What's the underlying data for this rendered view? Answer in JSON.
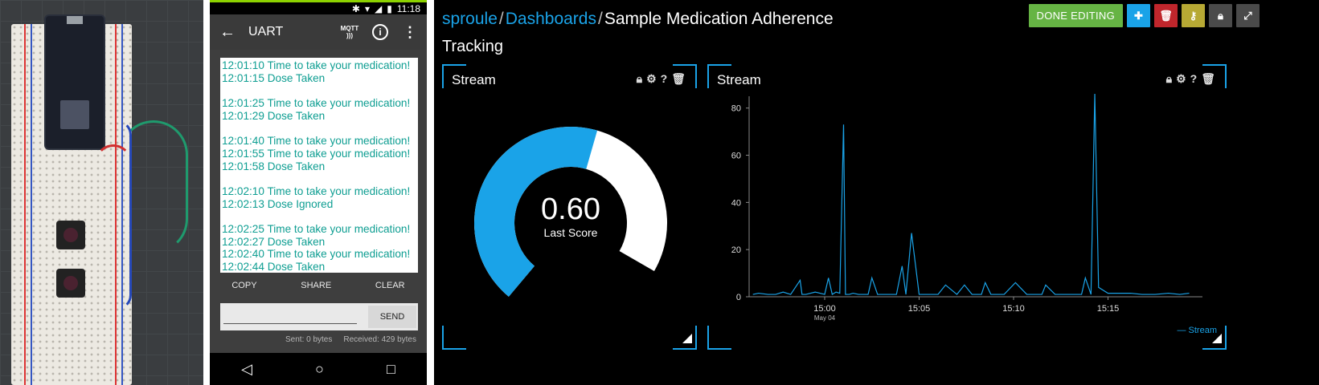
{
  "phone": {
    "status_time": "11:18",
    "title": "UART",
    "mqtt_label": "MQTT",
    "log_groups": [
      [
        "12:01:10 Time to take your medication!",
        "12:01:15 Dose Taken"
      ],
      [
        "12:01:25 Time to take your medication!",
        "12:01:29 Dose Taken"
      ],
      [
        "12:01:40 Time to take your medication!",
        "12:01:55 Time to take your medication!",
        "12:01:58 Dose Taken"
      ],
      [
        "12:02:10 Time to take your medication!",
        "12:02:13 Dose Ignored"
      ],
      [
        "12:02:25 Time to take your medication!",
        "12:02:27 Dose Taken",
        "12:02:40 Time to take your medication!",
        "12:02:44 Dose Taken"
      ]
    ],
    "actions": {
      "copy": "COPY",
      "share": "SHARE",
      "clear": "CLEAR"
    },
    "send_label": "SEND",
    "sent": "Sent: 0 bytes",
    "received": "Received: 429 bytes"
  },
  "dashboard": {
    "breadcrumb": {
      "user": "sproule",
      "dashboards": "Dashboards",
      "name": "Sample Medication Adherence"
    },
    "title_line2": "Tracking",
    "toolbar": {
      "done": "DONE EDITING"
    },
    "colors": {
      "accent": "#1aa3e8",
      "done": "#66b444",
      "add": "#1aa3e8",
      "delete": "#c0262c",
      "key": "#b7a934",
      "lock": "#4a4a4a",
      "expand": "#4a4a4a"
    },
    "gauge_widget": {
      "title": "Stream",
      "value": "0.60",
      "label": "Last Score",
      "fraction": 0.6
    },
    "chart_widget": {
      "title": "Stream",
      "legend": "— Stream"
    }
  },
  "chart_data": {
    "type": "line",
    "title": "",
    "xlabel": "",
    "ylabel": "",
    "ylim": [
      0,
      85
    ],
    "yticks": [
      "0",
      "20",
      "40",
      "60",
      "80"
    ],
    "xtick_labels": [
      "15:00",
      "15:05",
      "15:10",
      "15:15"
    ],
    "xtick_sublabel": "May 04",
    "xlim_minutes": [
      -4,
      20
    ],
    "series": [
      {
        "name": "Stream",
        "x_minutes": [
          -3.8,
          -3.5,
          -3.0,
          -2.6,
          -2.2,
          -1.8,
          -1.3,
          -1.2,
          -1.0,
          -0.5,
          0.0,
          0.2,
          0.4,
          0.6,
          0.8,
          1.0,
          1.1,
          1.2,
          1.3,
          1.5,
          1.8,
          2.3,
          2.5,
          2.8,
          3.3,
          3.8,
          4.1,
          4.3,
          4.6,
          5.0,
          5.6,
          6.0,
          6.4,
          7.0,
          7.4,
          7.8,
          8.3,
          8.5,
          8.8,
          9.5,
          10.1,
          10.7,
          11.5,
          11.7,
          12.2,
          13.0,
          13.6,
          13.8,
          14.1,
          14.3,
          14.5,
          15.0,
          15.6,
          16.2,
          16.8,
          17.5,
          18.2,
          18.8,
          19.3
        ],
        "values": [
          1,
          1.5,
          1,
          1,
          2,
          1,
          7,
          1,
          1,
          2,
          1,
          8,
          1,
          2,
          1.5,
          73,
          1,
          1,
          1,
          1.5,
          1,
          1,
          8,
          1,
          1,
          1,
          13,
          1,
          27,
          1,
          1,
          1,
          5,
          1,
          5,
          1,
          1,
          6,
          1,
          1,
          6,
          1,
          1,
          5,
          1,
          1,
          1,
          8,
          1,
          86,
          4,
          1.5,
          1.5,
          1.5,
          1,
          1,
          1.5,
          1,
          1.5
        ]
      }
    ]
  }
}
